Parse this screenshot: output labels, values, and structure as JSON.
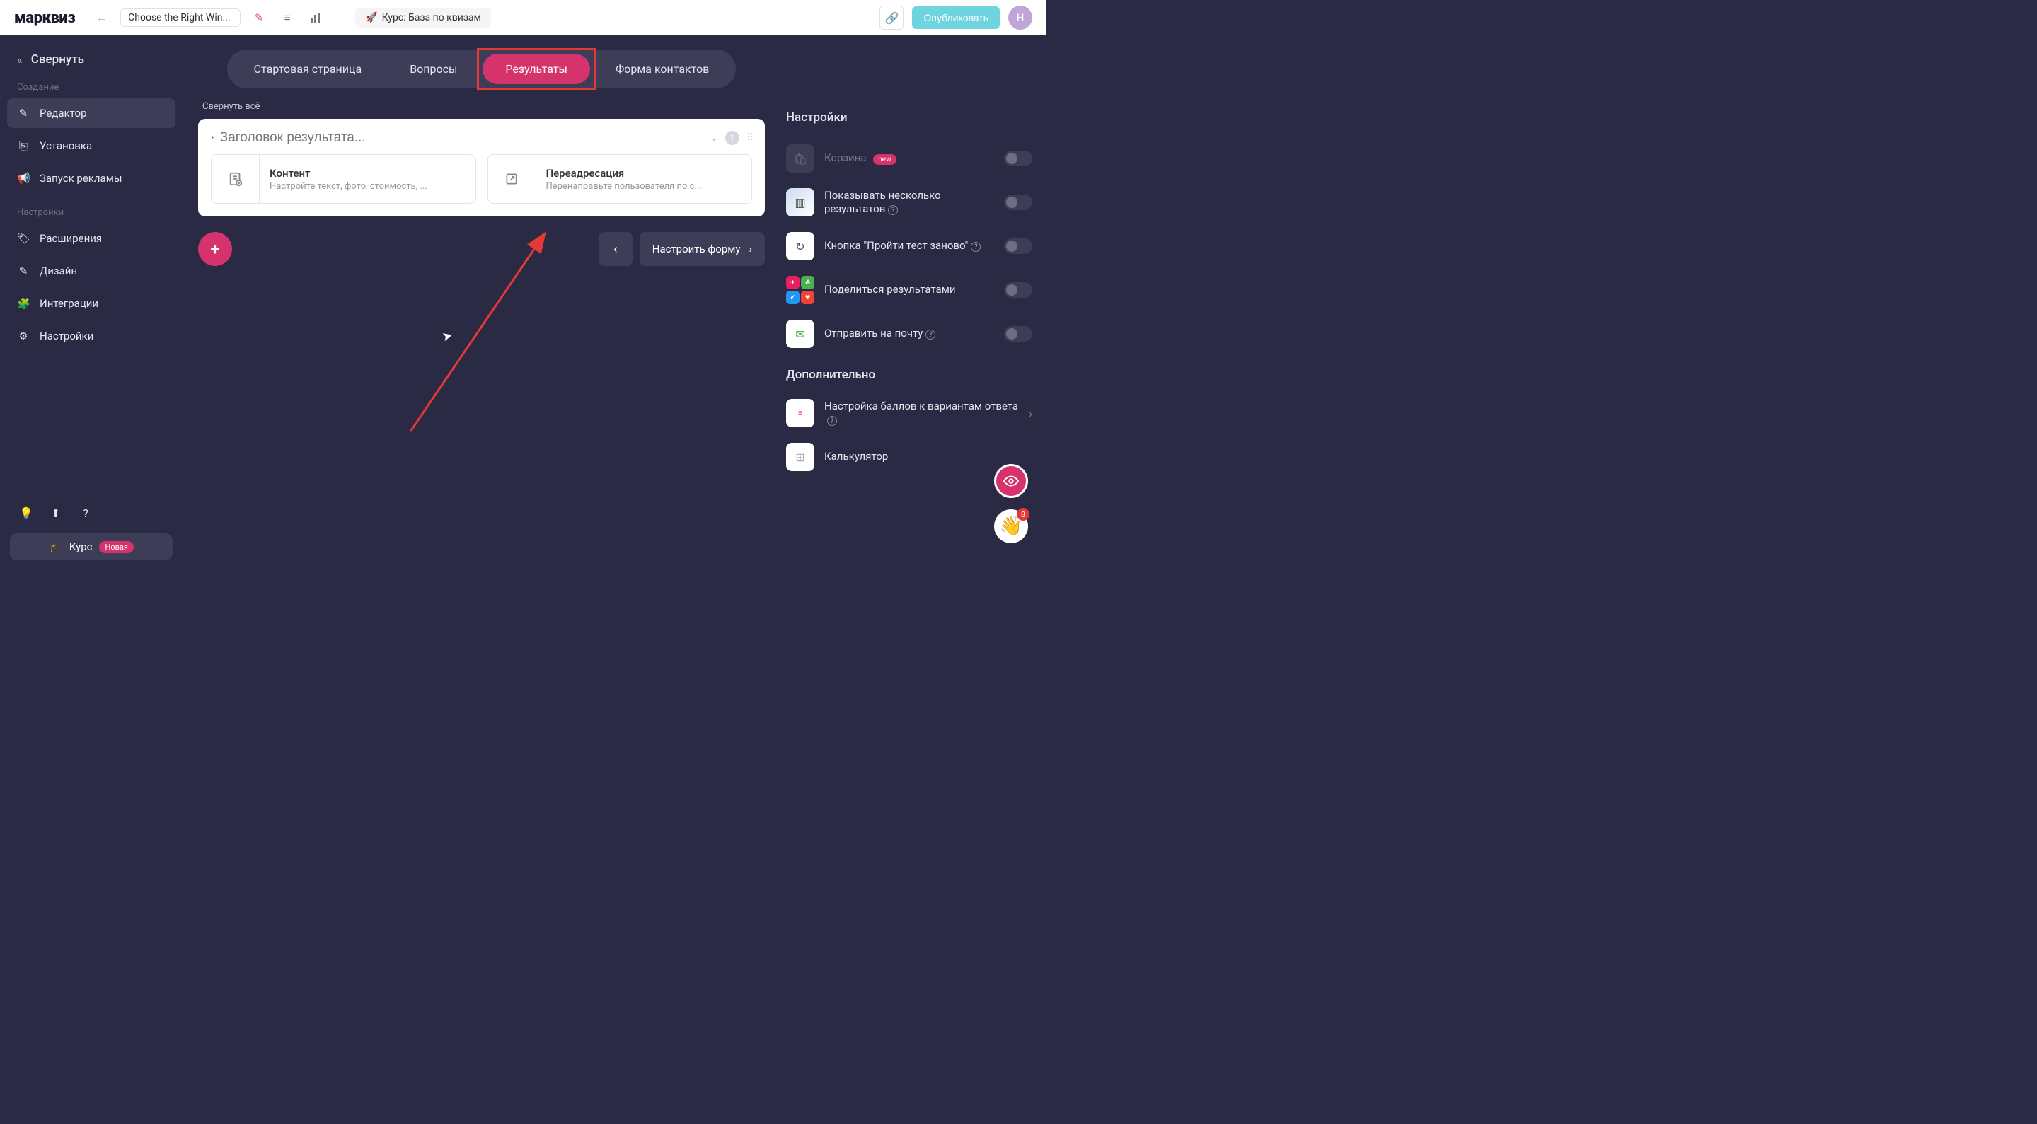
{
  "topbar": {
    "logo": "марквиз",
    "project_name": "Choose the Right Win...",
    "course_chip": "Курс: База по квизам",
    "publish": "Опубликовать",
    "avatar_letter": "Н"
  },
  "sidebar": {
    "collapse": "Свернуть",
    "section_create": "Создание",
    "items_create": [
      {
        "icon": "✎",
        "label": "Редактор",
        "active": true
      },
      {
        "icon": "⎘",
        "label": "Установка",
        "active": false
      },
      {
        "icon": "📢",
        "label": "Запуск рекламы",
        "active": false
      }
    ],
    "section_settings": "Настройки",
    "items_settings": [
      {
        "icon": "🏷",
        "label": "Расширения"
      },
      {
        "icon": "✎",
        "label": "Дизайн"
      },
      {
        "icon": "🧩",
        "label": "Интеграции"
      },
      {
        "icon": "⚙",
        "label": "Настройки"
      }
    ],
    "course_btn": "Курс",
    "course_badge": "Новая"
  },
  "tabs": [
    {
      "label": "Стартовая страница",
      "active": false
    },
    {
      "label": "Вопросы",
      "active": false
    },
    {
      "label": "Результаты",
      "active": true,
      "highlighted": true
    },
    {
      "label": "Форма контактов",
      "active": false
    }
  ],
  "center": {
    "collapse_all": "Свернуть всё",
    "title_placeholder": "Заголовок результата...",
    "badge_count": "1",
    "options": [
      {
        "title": "Контент",
        "desc": "Настройте текст, фото, стоимость, ..."
      },
      {
        "title": "Переадресация",
        "desc": "Перенаправьте пользователя по с..."
      }
    ],
    "configure_form": "Настроить форму"
  },
  "right": {
    "title": "Настройки",
    "settings": [
      {
        "label": "Корзина",
        "badge": "new",
        "disabled": true
      },
      {
        "label": "Показывать несколько результатов",
        "help": true
      },
      {
        "label": "Кнопка \"Пройти тест заново\"",
        "help": true
      },
      {
        "label": "Поделиться результатами"
      },
      {
        "label": "Отправить на почту",
        "help": true
      }
    ],
    "extra_title": "Дополнительно",
    "extras": [
      {
        "label": "Настройка баллов к вариантам ответа",
        "help": true,
        "chevron": true
      },
      {
        "label": "Калькулятор"
      }
    ]
  },
  "chat_badge": "8"
}
